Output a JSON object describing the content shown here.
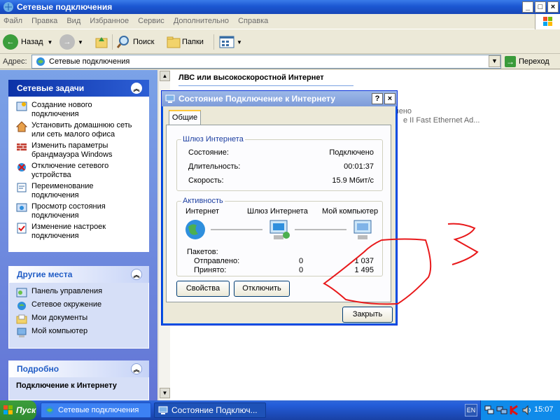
{
  "window": {
    "title": "Сетевые подключения",
    "controls": [
      "_",
      "□",
      "×"
    ]
  },
  "menu": [
    "Файл",
    "Правка",
    "Вид",
    "Избранное",
    "Сервис",
    "Дополнительно",
    "Справка"
  ],
  "toolbar": {
    "back": "Назад",
    "search": "Поиск",
    "folders": "Папки"
  },
  "address": {
    "label": "Адрес:",
    "value": "Сетевые подключения",
    "go": "Переход"
  },
  "tasks_panel": {
    "title": "Сетевые задачи",
    "items": [
      "Создание нового подключения",
      "Установить домашнюю сеть или сеть малого офиса",
      "Изменить параметры брандмауэра Windows",
      "Отключение сетевого устройства",
      "Переименование подключения",
      "Просмотр состояния подключения",
      "Изменение настроек подключения"
    ]
  },
  "other_places": {
    "title": "Другие места",
    "items": [
      "Панель управления",
      "Сетевое окружение",
      "Мои документы",
      "Мой компьютер"
    ]
  },
  "details_panel": {
    "title": "Подробно",
    "name": "Подключение к Интернету"
  },
  "content": {
    "group_header": "ЛВС или высокоскоростной Интернет",
    "partial_text_1": "чено",
    "partial_text_2": "e II Fast Ethernet Ad..."
  },
  "dialog": {
    "title": "Состояние Подключение к Интернету",
    "help": "?",
    "close_x": "×",
    "tab": "Общие",
    "gateway_group": {
      "title": "Шлюз Интернета",
      "rows": [
        {
          "label": "Состояние:",
          "value": "Подключено"
        },
        {
          "label": "Длительность:",
          "value": "00:01:37"
        },
        {
          "label": "Скорость:",
          "value": "15.9 Мбит/с"
        }
      ]
    },
    "activity_group": {
      "title": "Активность",
      "nodes": [
        "Интернет",
        "Шлюз Интернета",
        "Мой компьютер"
      ],
      "packets_label": "Пакетов:",
      "sent_label": "Отправлено:",
      "sent_a": "0",
      "sent_b": "1 037",
      "recv_label": "Принято:",
      "recv_a": "0",
      "recv_b": "1 495"
    },
    "btn_properties": "Свойства",
    "btn_disconnect": "Отключить",
    "btn_close": "Закрыть"
  },
  "taskbar": {
    "start": "Пуск",
    "items": [
      "Сетевые подключения",
      "Состояние Подключ..."
    ],
    "lang": "EN",
    "time": "15:07"
  },
  "colors": {
    "title_blue": "#1b57d2",
    "pane_blue": "#6375d6",
    "annotation_red": "#e8181a"
  }
}
